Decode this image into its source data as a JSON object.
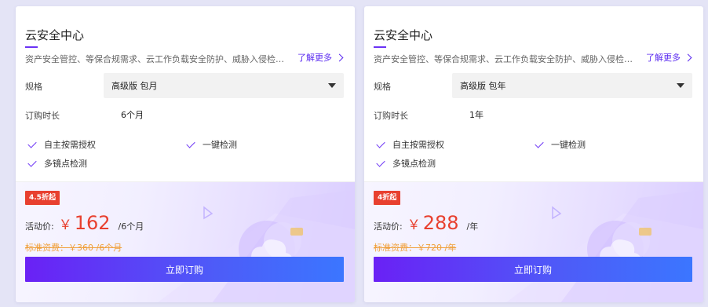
{
  "cards": [
    {
      "title": "云安全中心",
      "description": "资产安全管控、等保合规需求、云工作负载安全防护、威胁入侵检测与...",
      "more_label": "了解更多",
      "spec_label": "规格",
      "spec_value": "高级版 包月",
      "duration_label": "订购时长",
      "duration_value": "6个月",
      "features": [
        "自主按需授权",
        "一键检测",
        "多镜点检测"
      ],
      "badge": "4.5折起",
      "price_label": "活动价:",
      "price_symbol": "￥",
      "price": "162",
      "price_unit": "/6个月",
      "original_price": "标准资费：￥360 /6个月",
      "buy_label": "立即订购"
    },
    {
      "title": "云安全中心",
      "description": "资产安全管控、等保合规需求、云工作负载安全防护、威胁入侵检测与...",
      "more_label": "了解更多",
      "spec_label": "规格",
      "spec_value": "高级版 包年",
      "duration_label": "订购时长",
      "duration_value": "1年",
      "features": [
        "自主按需授权",
        "一键检测",
        "多镜点检测"
      ],
      "badge": "4折起",
      "price_label": "活动价:",
      "price_symbol": "￥",
      "price": "288",
      "price_unit": "/年",
      "original_price": "标准资费：￥720 /年",
      "buy_label": "立即订购"
    }
  ],
  "colors": {
    "accent": "#6a32f5",
    "price_red": "#e8402f",
    "original_price_orange": "#f0a03c",
    "button_start": "#6a21f5",
    "button_end": "#3b76ff"
  }
}
